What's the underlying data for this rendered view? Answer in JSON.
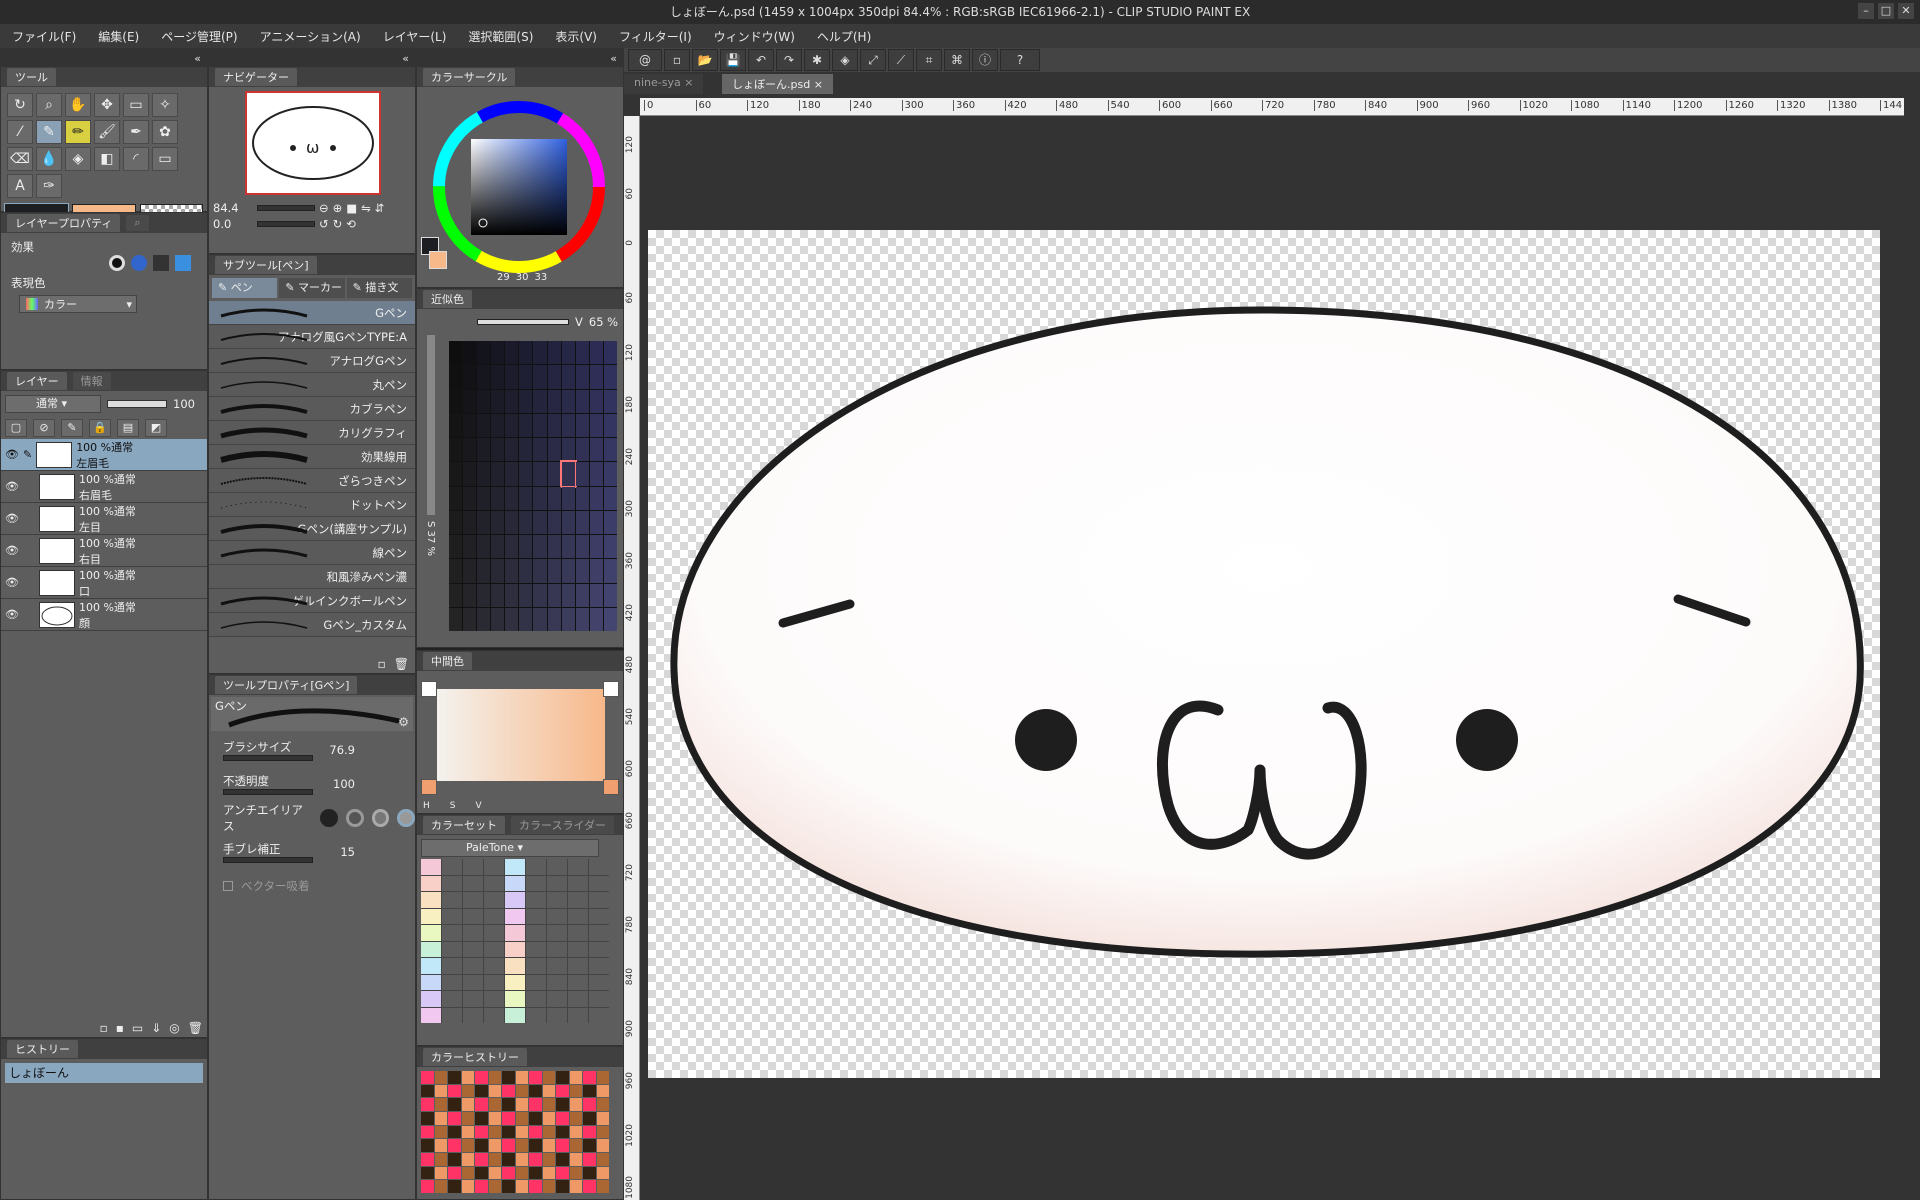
{
  "title_bar": {
    "title": "しょぼーん.psd (1459 x 1004px 350dpi 84.4% : RGB:sRGB IEC61966-2.1)  - CLIP STUDIO PAINT EX"
  },
  "menu": [
    "ファイル(F)",
    "編集(E)",
    "ページ管理(P)",
    "アニメーション(A)",
    "レイヤー(L)",
    "選択範囲(S)",
    "表示(V)",
    "フィルター(I)",
    "ウィンドウ(W)",
    "ヘルプ(H)"
  ],
  "tool_panel": {
    "tab": "ツール"
  },
  "layer_property": {
    "tab": "レイヤープロパティ",
    "effect_label": "効果",
    "display_color_label": "表現色",
    "display_color_value": "カラー"
  },
  "layers": {
    "tab": "レイヤー",
    "tab2": "情報",
    "blend_mode": "通常",
    "opacity": "100",
    "items": [
      {
        "mode": "100 %通常",
        "name": "左眉毛"
      },
      {
        "mode": "100 %通常",
        "name": "右眉毛"
      },
      {
        "mode": "100 %通常",
        "name": "左目"
      },
      {
        "mode": "100 %通常",
        "name": "右目"
      },
      {
        "mode": "100 %通常",
        "name": "口"
      },
      {
        "mode": "100 %通常",
        "name": "顔"
      }
    ]
  },
  "history": {
    "tab": "ヒストリー",
    "item": "しょぼーん"
  },
  "navigator": {
    "tab": "ナビゲーター",
    "zoom": "84.4",
    "angle": "0.0"
  },
  "sub_tool": {
    "tab": "サブツール[ペン]",
    "tabs": [
      "ペン",
      "マーカー",
      "描き文"
    ],
    "brushes": [
      "Gペン",
      "アナログ風GペンTYPE:A",
      "アナログGペン",
      "丸ペン",
      "カブラペン",
      "カリグラフィ",
      "効果線用",
      "ざらつきペン",
      "ドットペン",
      "Gペン(講座サンプル)",
      "線ペン",
      "和風滲みペン濃",
      "ゲルインクボールペン",
      "Gペン_カスタム"
    ]
  },
  "tool_property": {
    "tab": "ツールプロパティ[Gペン]",
    "preset": "Gペン",
    "brush_size_label": "ブラシサイズ",
    "brush_size": "76.9",
    "opacity_label": "不透明度",
    "opacity": "100",
    "antialias_label": "アンチエイリアス",
    "stabilize_label": "手ブレ補正",
    "stabilize": "15",
    "vector_label": "ベクター吸着"
  },
  "color_circle": {
    "tab": "カラーサークル",
    "r": "29",
    "g": "30",
    "b": "33"
  },
  "approx_color": {
    "tab": "近似色",
    "v_label": "V",
    "v_value": "65 %",
    "s_label": "S",
    "s_value": "37 %"
  },
  "mid_color": {
    "tab": "中間色",
    "h": "H",
    "s": "S",
    "v": "V"
  },
  "color_set": {
    "tab": "カラーセット",
    "tab2": "カラースライダー",
    "set_name": "PaleTone"
  },
  "color_history": {
    "tab": "カラーヒストリー"
  },
  "canvas": {
    "doc_tabs": [
      "nine-sya",
      "しょぼーん.psd"
    ],
    "ruler_ticks": [
      "0",
      "60",
      "120",
      "180",
      "240",
      "300",
      "360",
      "420",
      "480",
      "540",
      "600",
      "660",
      "720",
      "780",
      "840",
      "900",
      "960",
      "1020",
      "1080",
      "1140",
      "1200",
      "1260",
      "1320",
      "1380",
      "144"
    ],
    "vruler_ticks": [
      "120",
      "60",
      "0",
      "60",
      "120",
      "180",
      "240",
      "300",
      "360",
      "420",
      "480",
      "540",
      "600",
      "660",
      "720",
      "780",
      "840",
      "900",
      "960",
      "1020",
      "1080"
    ]
  },
  "colors": {
    "accent": "#8aa7c0",
    "main_color": "#1d1e21",
    "sub_color": "#f7b88a",
    "panel_bg": "#5d5d5d",
    "dark_bg": "#333333"
  }
}
